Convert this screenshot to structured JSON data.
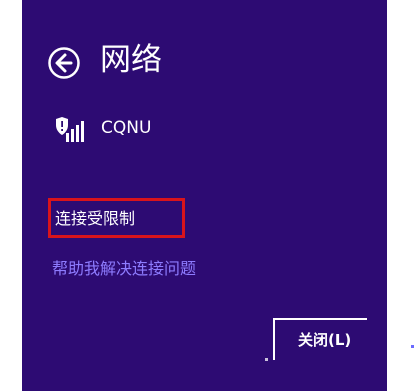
{
  "header": {
    "title": "网络",
    "back_icon": "arrow-left-circle-icon"
  },
  "network": {
    "name": "CQNU",
    "icon": "wifi-signal-shield-icon"
  },
  "status": {
    "text": "连接受限制"
  },
  "help": {
    "text": "帮助我解决连接问题"
  },
  "footer": {
    "close_label": "关闭(L)"
  },
  "colors": {
    "panel": "#2d0b73",
    "highlight": "#d9141b",
    "link": "#8e7cff",
    "text": "#ffffff"
  }
}
